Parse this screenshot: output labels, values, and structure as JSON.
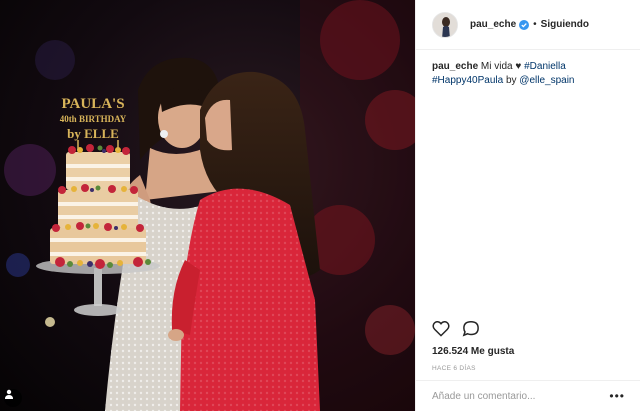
{
  "post": {
    "username": "pau_eche",
    "follow_status": "Siguiendo",
    "separator": "•",
    "photo": {
      "cake_topper": [
        "PAULA'S",
        "40th BIRTHDAY",
        "by ELLE"
      ]
    },
    "caption": {
      "username": "pau_eche",
      "text": "Mi vida",
      "heart": "♥",
      "hashtag1": "#Daniella",
      "hashtag2": "#Happy40Paula",
      "by": "by",
      "mention": "@elle_spain"
    },
    "likes": "126.524 Me gusta",
    "time": "HACE 6 DÍAS",
    "comment_placeholder": "Añade un comentario...",
    "more": "•••"
  },
  "colors": {
    "link": "#003569",
    "verified": "#3897f0",
    "dress": "#d9263a",
    "topper_gold": "#d8b45a"
  },
  "icons": [
    "heart-icon",
    "comment-icon",
    "verified-icon",
    "user-tag-icon",
    "more-options-icon"
  ]
}
